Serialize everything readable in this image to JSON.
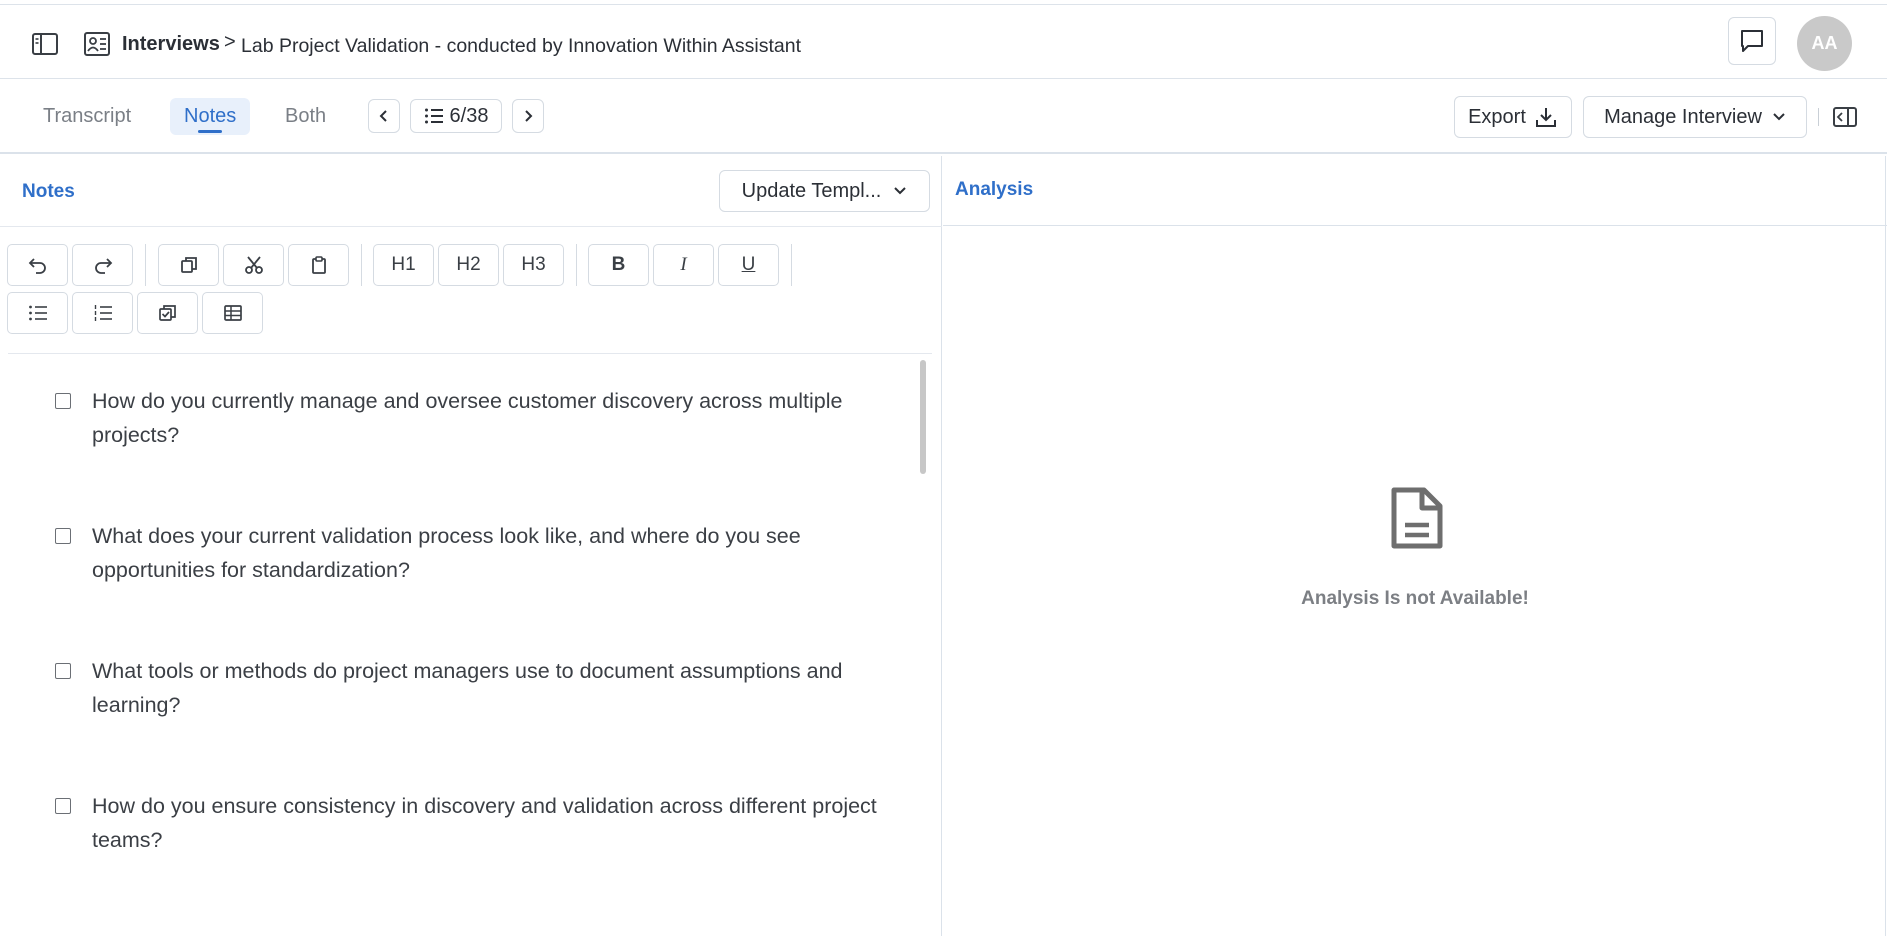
{
  "header": {
    "breadcrumb_root": "Interviews",
    "breadcrumb_separator": ">",
    "page_title": "Lab Project Validation - conducted by Innovation Within Assistant",
    "avatar_initials": "AA"
  },
  "tabs": {
    "items": [
      {
        "label": "Transcript",
        "active": false
      },
      {
        "label": "Notes",
        "active": true
      },
      {
        "label": "Both",
        "active": false
      }
    ],
    "pager": "6/38",
    "export_label": "Export",
    "manage_label": "Manage Interview"
  },
  "notes": {
    "title": "Notes",
    "template_label": "Update Templ...",
    "toolbar": {
      "h1": "H1",
      "h2": "H2",
      "h3": "H3",
      "bold": "B",
      "italic": "I",
      "underline": "U"
    },
    "questions": [
      "How do you currently manage and oversee customer discovery across multiple projects?",
      "What does your current validation process look like, and where do you see opportunities for standardization?",
      "What tools or methods do project managers use to document assumptions and learning?",
      "How do you ensure consistency in discovery and validation across different project teams?"
    ]
  },
  "analysis": {
    "title": "Analysis",
    "empty_message": "Analysis Is not Available!"
  },
  "colors": {
    "accent": "#2f6fc9",
    "active_tab_bg": "#e8f0fb",
    "border": "#d5dbe2",
    "avatar_bg": "#c9c9c9",
    "muted_text": "#7c7f84"
  }
}
